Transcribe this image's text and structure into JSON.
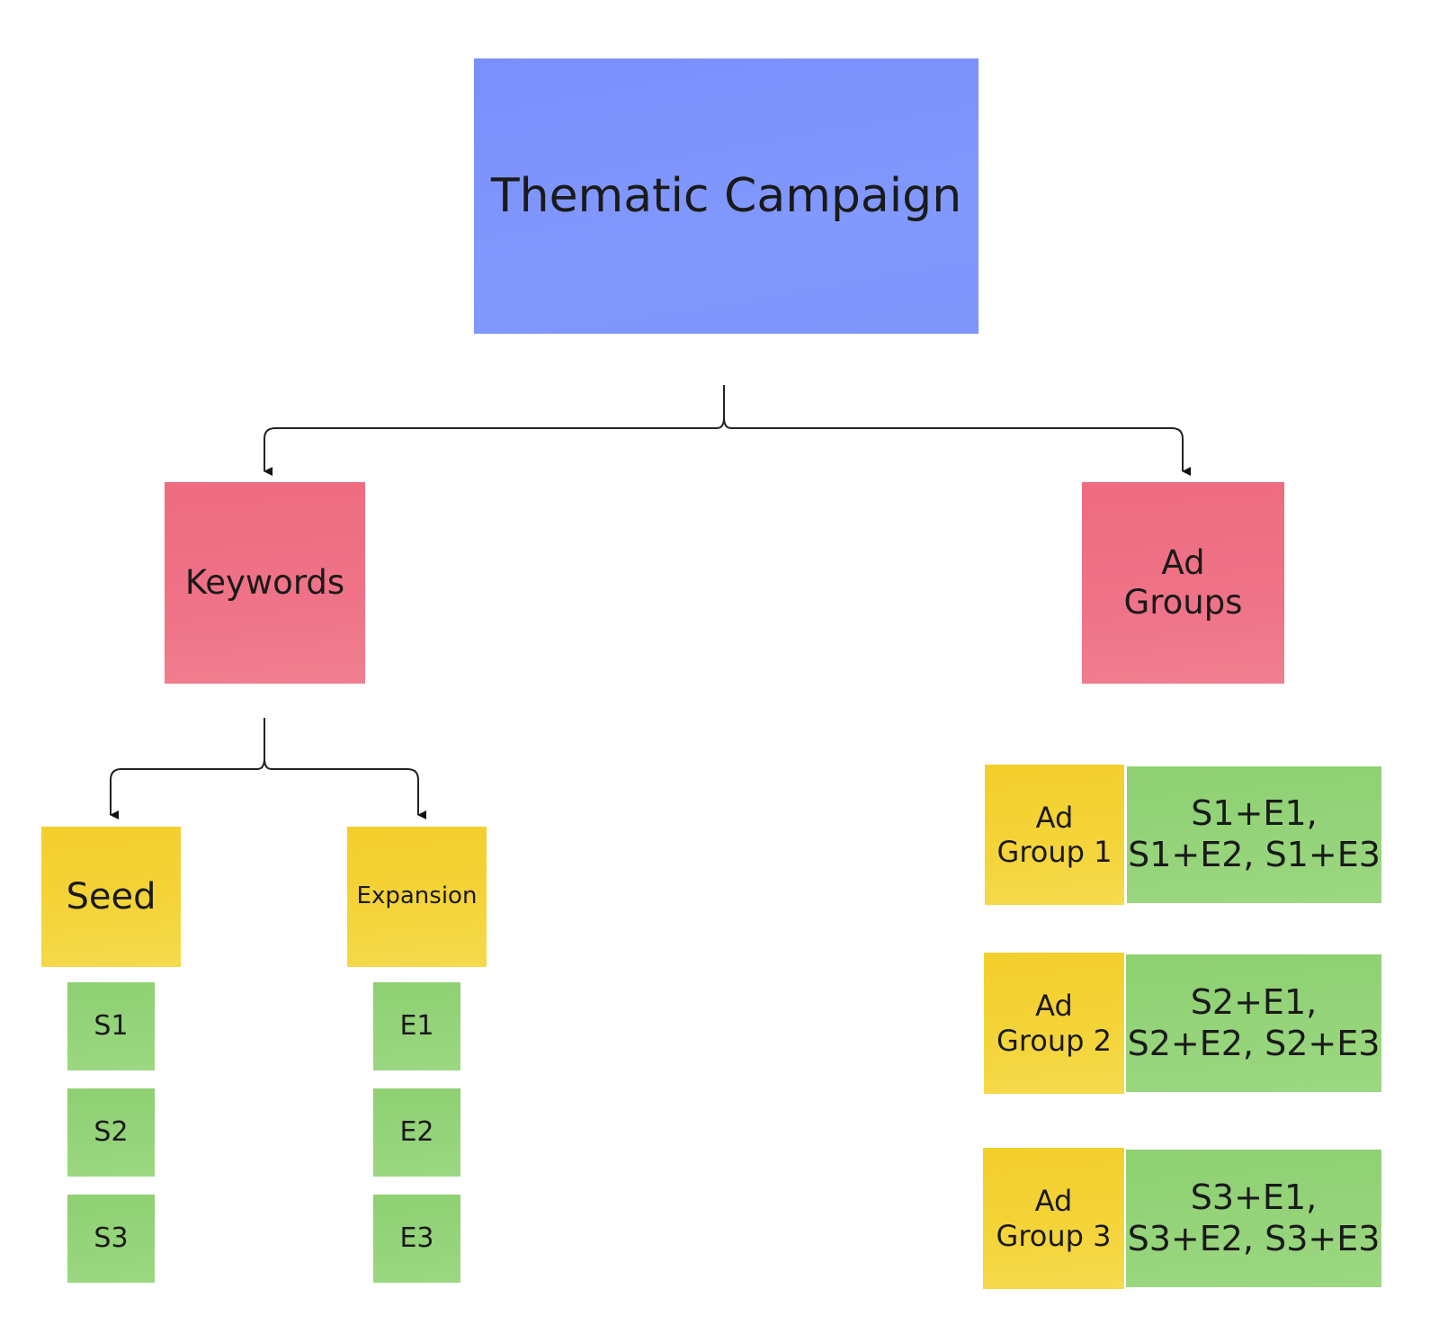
{
  "diagram": {
    "root": {
      "label": "Thematic Campaign",
      "color": "#7f95fb"
    },
    "branches": [
      {
        "label": "Keywords",
        "color": "#ef7388"
      },
      {
        "label": "Ad\nGroups",
        "color": "#ef7388"
      }
    ],
    "keyword_types": [
      {
        "label": "Seed",
        "color": "#f4d43a",
        "items": [
          "S1",
          "S2",
          "S3"
        ]
      },
      {
        "label": "Expansion",
        "color": "#f4d43a",
        "items": [
          "E1",
          "E2",
          "E3"
        ]
      }
    ],
    "ad_groups": [
      {
        "label": "Ad\nGroup 1",
        "combos": "S1+E1,\nS1+E2, S1+E3"
      },
      {
        "label": "Ad\nGroup 2",
        "combos": "S2+E1,\nS2+E2, S2+E3"
      },
      {
        "label": "Ad\nGroup 3",
        "combos": "S3+E1,\nS3+E2, S3+E3"
      }
    ],
    "item_color": "#96d47b"
  }
}
